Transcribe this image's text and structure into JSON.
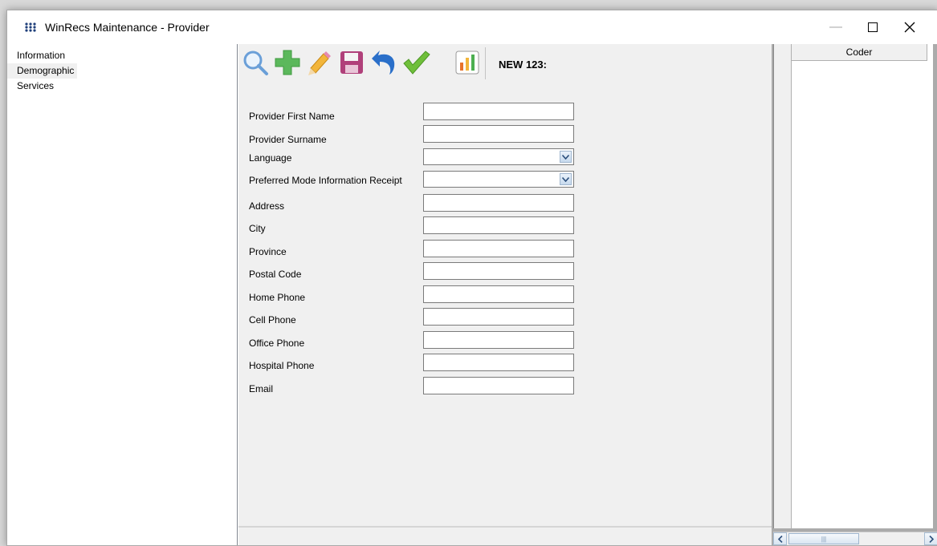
{
  "window": {
    "title": "WinRecs Maintenance - Provider"
  },
  "sidebar": {
    "items": [
      {
        "label": "Information"
      },
      {
        "label": "Demographic"
      },
      {
        "label": "Services"
      }
    ]
  },
  "toolbar": {
    "buttons": [
      {
        "name": "search-button",
        "icon": "magnifier-icon"
      },
      {
        "name": "add-button",
        "icon": "plus-icon"
      },
      {
        "name": "edit-button",
        "icon": "pencil-icon"
      },
      {
        "name": "save-button",
        "icon": "floppy-disk-icon"
      },
      {
        "name": "undo-button",
        "icon": "undo-arrow-icon"
      },
      {
        "name": "accept-button",
        "icon": "checkmark-icon"
      },
      {
        "name": "report-button",
        "icon": "bar-chart-icon"
      }
    ],
    "record_label": "NEW 123:"
  },
  "form": {
    "fields": [
      {
        "label": "Provider First Name",
        "type": "text",
        "value": ""
      },
      {
        "label": "Provider Surname",
        "type": "text",
        "value": ""
      },
      {
        "label": "Language",
        "type": "select",
        "value": ""
      },
      {
        "label": "Preferred Mode Information Receipt",
        "type": "select",
        "value": ""
      },
      {
        "label": "Address",
        "type": "text",
        "value": ""
      },
      {
        "label": "City",
        "type": "text",
        "value": ""
      },
      {
        "label": "Province",
        "type": "text",
        "value": ""
      },
      {
        "label": "Postal Code",
        "type": "text",
        "value": ""
      },
      {
        "label": "Home Phone",
        "type": "text",
        "value": ""
      },
      {
        "label": "Cell Phone",
        "type": "text",
        "value": ""
      },
      {
        "label": "Office Phone",
        "type": "text",
        "value": ""
      },
      {
        "label": "Hospital Phone",
        "type": "text",
        "value": ""
      },
      {
        "label": "Email",
        "type": "text",
        "value": ""
      }
    ]
  },
  "grid": {
    "columns": [
      "Coder"
    ]
  },
  "colors": {
    "add": "#5cb85c",
    "check": "#6fbf3a",
    "save": "#b0407a",
    "undo": "#2a6fc9",
    "search": "#6a9fd8"
  }
}
